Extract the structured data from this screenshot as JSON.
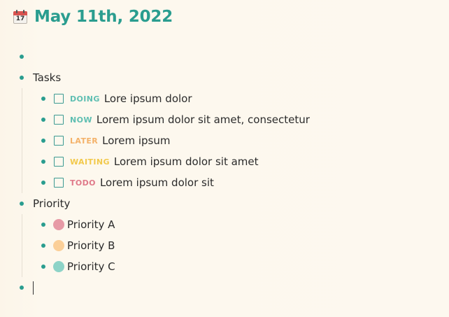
{
  "page": {
    "icon": "calendar-icon",
    "icon_day": "17",
    "title": "May 11th, 2022"
  },
  "colors": {
    "accent": "#2a9d8f",
    "doing": "#5fbfb2",
    "now": "#5fbfb2",
    "later": "#f4b26a",
    "waiting": "#f2c94c",
    "todo": "#e07a8a",
    "priority_a": "#e79aa6",
    "priority_b": "#fbcf98",
    "priority_c": "#8dd3c7"
  },
  "blocks": {
    "tasks_label": "Tasks",
    "tasks": [
      {
        "marker": "DOING",
        "text": "Lore ipsum dolor"
      },
      {
        "marker": "NOW",
        "text": "Lorem ipsum dolor sit amet, consectetur"
      },
      {
        "marker": "LATER",
        "text": "Lorem ipsum"
      },
      {
        "marker": "WAITING",
        "text": "Lorem ipsum dolor sit amet"
      },
      {
        "marker": "TODO",
        "text": "Lorem ipsum dolor sit"
      }
    ],
    "priority_label": "Priority",
    "priorities": [
      {
        "label": "Priority A"
      },
      {
        "label": "Priority B"
      },
      {
        "label": "Priority C"
      }
    ]
  }
}
